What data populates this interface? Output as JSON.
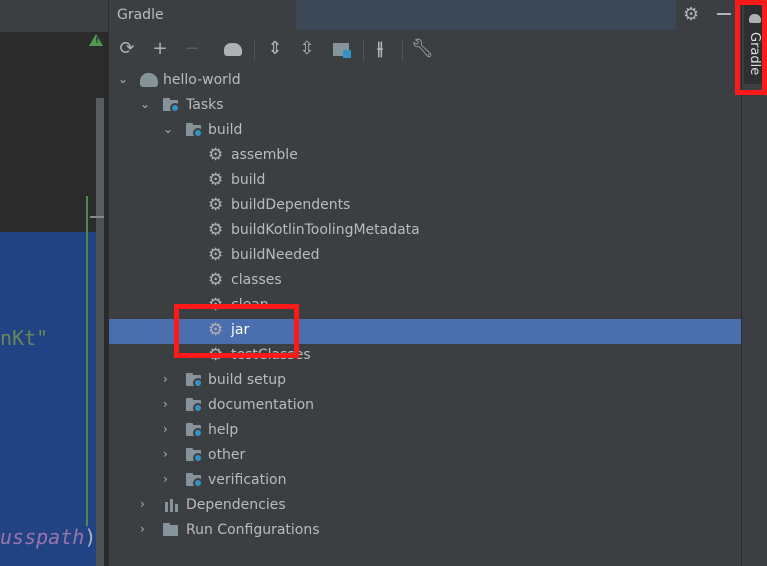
{
  "tool_window": {
    "title": "Gradle",
    "stripe_label": "Gradle"
  },
  "editor": {
    "code_line_1": "nKt\"",
    "code_line_2": "usspath",
    "code_line_2_paren": ")"
  },
  "toolbar": {
    "refresh": "refresh-icon",
    "add": "add-icon",
    "remove": "remove-icon",
    "gradle": "elephant-icon",
    "expand_all": "expand-all-icon",
    "collapse_all": "collapse-all-icon",
    "group": "group-modules-icon",
    "offline": "toggle-offline-icon",
    "settings": "wrench-icon"
  },
  "tree": {
    "root": "hello-world",
    "tasks": "Tasks",
    "build_group": "build",
    "build_tasks": [
      "assemble",
      "build",
      "buildDependents",
      "buildKotlinToolingMetadata",
      "buildNeeded",
      "classes",
      "clean",
      "jar",
      "testClasses"
    ],
    "other_groups": [
      "build setup",
      "documentation",
      "help",
      "other",
      "verification"
    ],
    "dependencies": "Dependencies",
    "run_configurations": "Run Configurations",
    "selected": "jar"
  }
}
